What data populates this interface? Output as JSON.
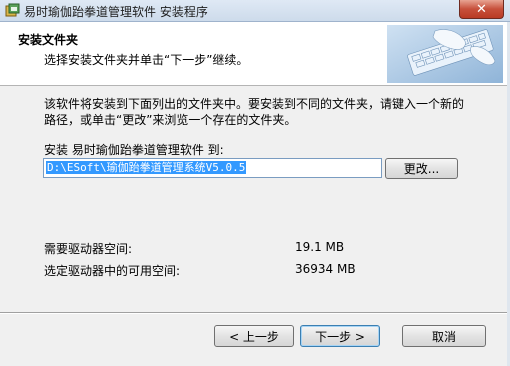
{
  "window": {
    "title": "易时瑜伽跆拳道管理软件 安装程序",
    "close_glyph": "✕"
  },
  "header": {
    "title": "安装文件夹",
    "subtitle": "选择安装文件夹并单击“下一步”继续。"
  },
  "body": {
    "description": "该软件将安装到下面列出的文件夹中。要安装到不同的文件夹，请键入一个新的路径，或单击“更改”来浏览一个存在的文件夹。",
    "install_label": "安装 易时瑜伽跆拳道管理软件 到:",
    "install_path": "D:\\ESoft\\瑜伽跆拳道管理系统V5.0.5",
    "browse_label": "更改...",
    "required_space_label": "需要驱动器空间:",
    "required_space_value": "19.1 MB",
    "available_space_label": "选定驱动器中的可用空间:",
    "available_space_value": "36934 MB"
  },
  "footer": {
    "back_label": "< 上一步",
    "next_label": "下一步 >",
    "cancel_label": "取消"
  },
  "icons": {
    "app": "installer-app-icon",
    "header_art": "keyboard-hands-image"
  },
  "colors": {
    "selection": "#3399ff",
    "close_button": "#c7503b",
    "default_button_border": "#3c7fb1"
  }
}
